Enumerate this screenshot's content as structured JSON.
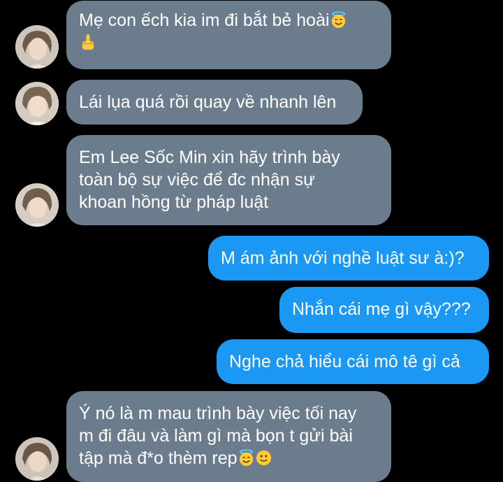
{
  "colors": {
    "background": "#000000",
    "incoming_bubble": "#6b7d8d",
    "outgoing_bubble": "#1a98f3",
    "text": "#ffffff"
  },
  "messages": [
    {
      "direction": "incoming",
      "lines": [
        "Mẹ con ếch kia im đi bắt bẻ hoài"
      ],
      "emojis": [
        "smiling-face-with-halo",
        "middle-finger"
      ]
    },
    {
      "direction": "incoming",
      "lines": [
        "Lái lụa quá rồi quay về nhanh lên"
      ]
    },
    {
      "direction": "incoming",
      "lines": [
        "Em Lee Sốc Min xin hãy trình bày",
        "toàn bộ sự việc để đc nhận sự",
        "khoan hồng từ pháp luật"
      ]
    },
    {
      "direction": "outgoing",
      "lines": [
        "M ám ảnh với nghề luật sư à:)?"
      ]
    },
    {
      "direction": "outgoing",
      "lines": [
        "Nhắn cái mẹ gì vậy???"
      ]
    },
    {
      "direction": "outgoing",
      "lines": [
        "Nghe chả hiểu cái mô tê gì cả"
      ]
    },
    {
      "direction": "incoming",
      "lines": [
        "Ý nó là m mau trình bày việc tối nay",
        "m đi đâu và làm gì mà bọn t gửi bài",
        "tập mà đ*o thèm rep"
      ],
      "emojis": [
        "smiling-face-with-halo",
        "slightly-smiling-face"
      ]
    }
  ]
}
